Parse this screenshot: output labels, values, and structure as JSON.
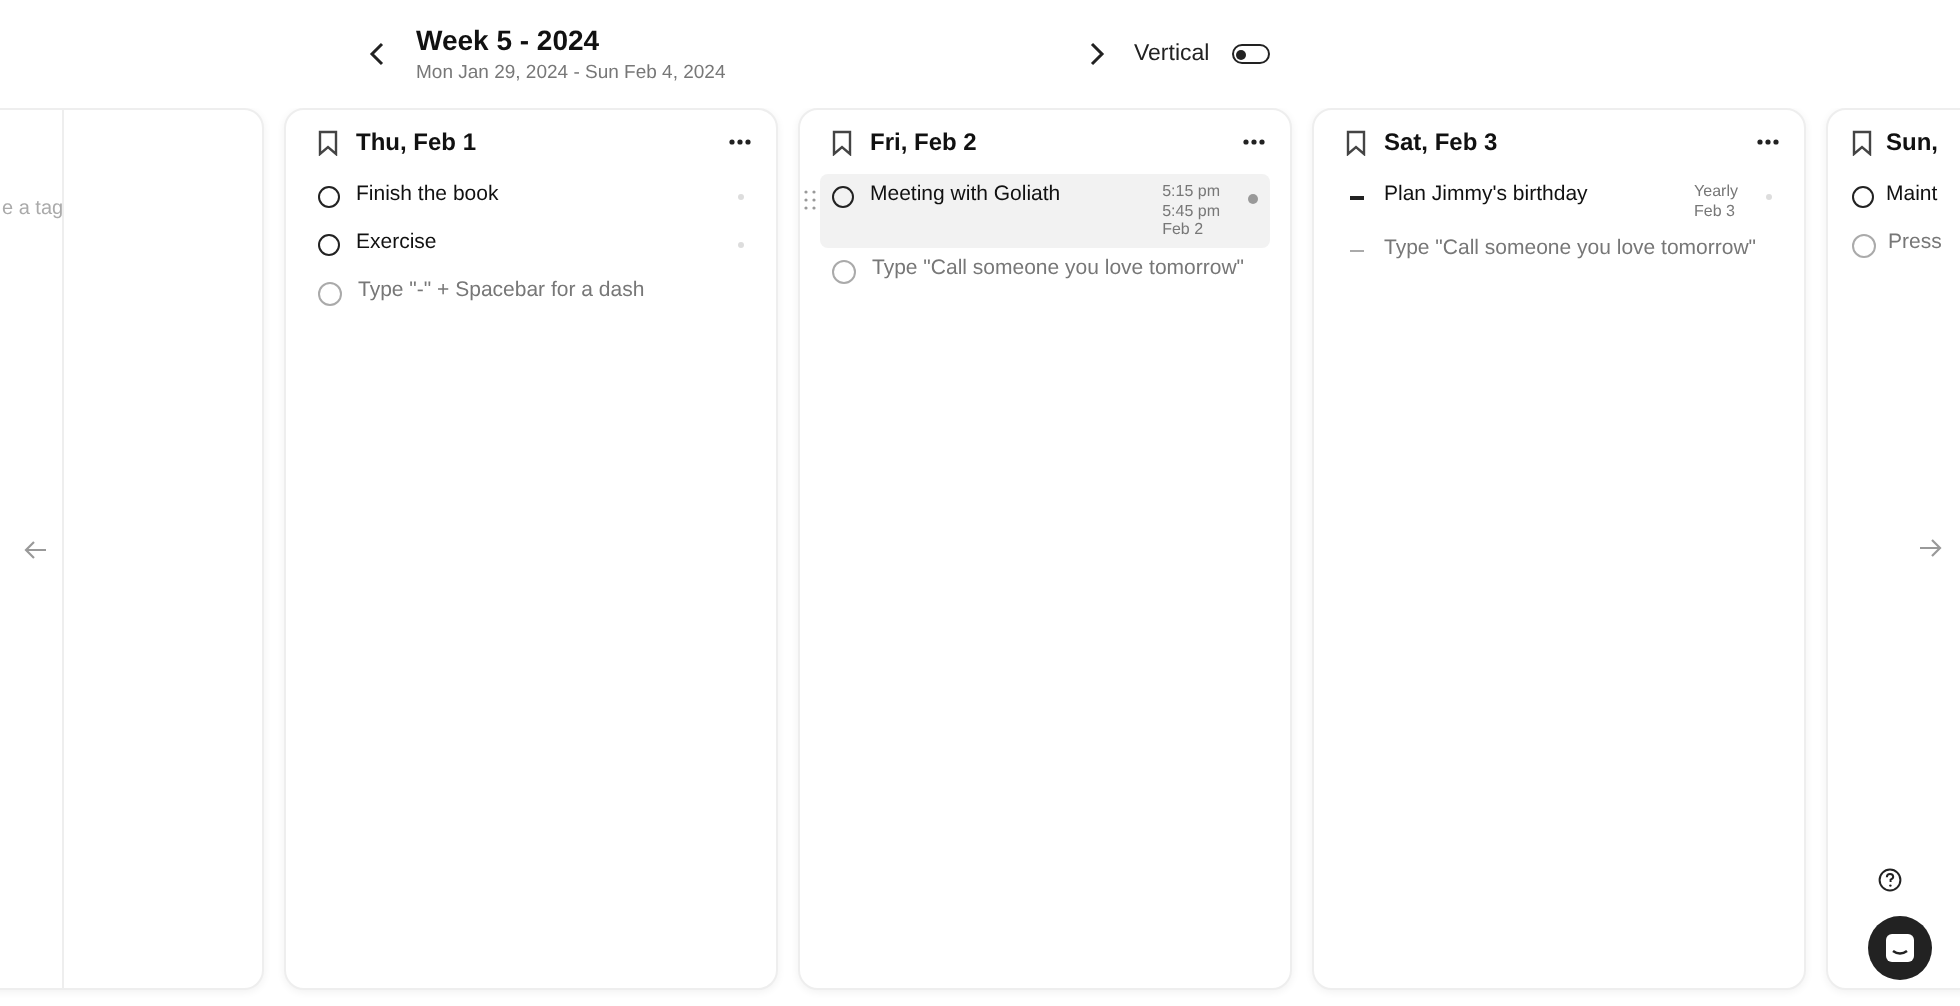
{
  "header": {
    "title": "Week 5 - 2024",
    "date_range": "Mon Jan 29, 2024 - Sun Feb 4, 2024",
    "view_label": "Vertical",
    "vertical_on": false
  },
  "left_column": {
    "items": [
      {
        "kind": "placeholder",
        "text": "e a tag"
      }
    ]
  },
  "days": [
    {
      "title": "Thu, Feb 1",
      "items": [
        {
          "kind": "task",
          "text": "Finish the book",
          "highlighted": false
        },
        {
          "kind": "task",
          "text": "Exercise",
          "highlighted": false
        },
        {
          "kind": "placeholder",
          "text": "Type \"-\" + Spacebar for a dash",
          "highlighted": false
        }
      ]
    },
    {
      "title": "Fri, Feb 2",
      "items": [
        {
          "kind": "task",
          "text": "Meeting with Goliath",
          "meta": [
            "5:15 pm",
            "5:45 pm",
            "Feb 2"
          ],
          "highlighted": true
        },
        {
          "kind": "placeholder",
          "text": "Type \"Call someone you love tomorrow\"",
          "highlighted": false
        }
      ]
    },
    {
      "title": "Sat, Feb 3",
      "items": [
        {
          "kind": "dash",
          "text": "Plan Jimmy's birthday",
          "meta": [
            "Yearly",
            "Feb 3"
          ],
          "highlighted": false
        },
        {
          "kind": "dash-placeholder",
          "text": "Type \"Call someone you love tomorrow\"",
          "highlighted": false
        }
      ]
    }
  ],
  "right_column": {
    "title": "Sun,",
    "items": [
      {
        "kind": "task",
        "text": "Maint"
      },
      {
        "kind": "placeholder",
        "text": "Press"
      }
    ]
  }
}
